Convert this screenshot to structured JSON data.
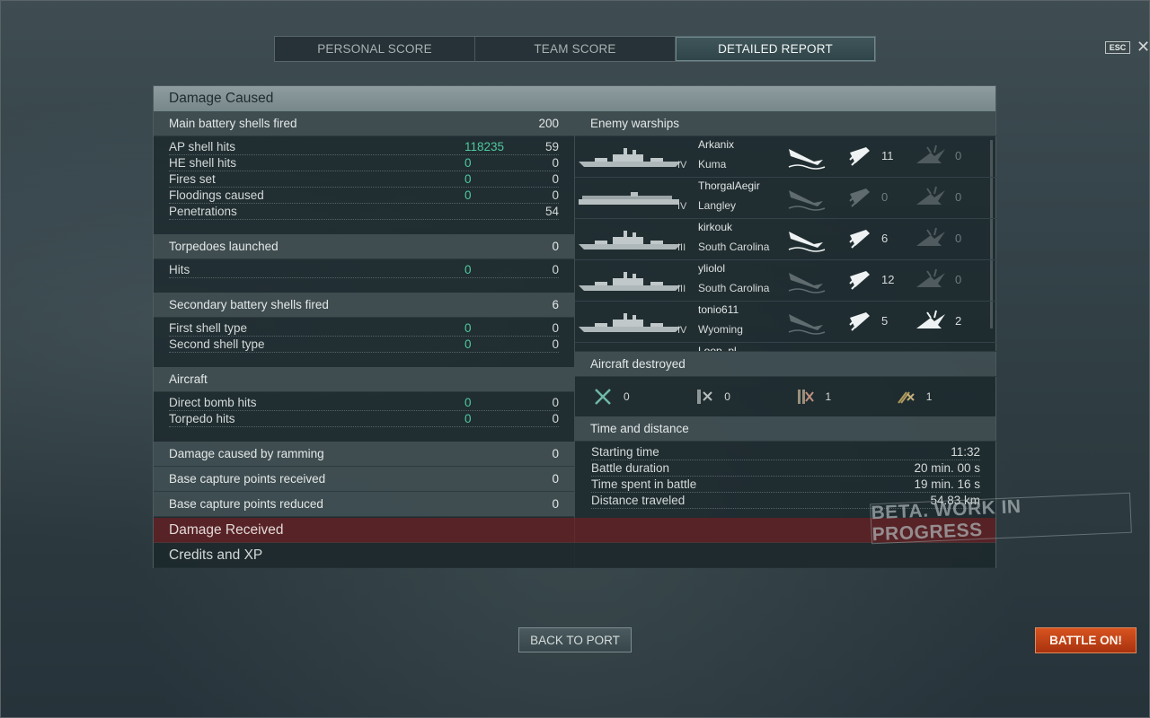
{
  "tabs": [
    {
      "label": "PERSONAL SCORE"
    },
    {
      "label": "TEAM SCORE"
    },
    {
      "label": "DETAILED REPORT"
    }
  ],
  "esc_label": "ESC",
  "close_glyph": "✕",
  "panel": {
    "title": "Damage Caused",
    "main_battery": {
      "title": "Main battery shells fired",
      "value": "200",
      "rows": [
        {
          "label": "AP shell hits",
          "v1": "118235",
          "v2": "59"
        },
        {
          "label": "HE shell hits",
          "v1": "0",
          "v2": "0"
        },
        {
          "label": "Fires set",
          "v1": "0",
          "v2": "0"
        },
        {
          "label": "Floodings caused",
          "v1": "0",
          "v2": "0"
        },
        {
          "label": "Penetrations",
          "v1": "",
          "v2": "54"
        }
      ]
    },
    "torpedoes": {
      "title": "Torpedoes launched",
      "value": "0",
      "rows": [
        {
          "label": "Hits",
          "v1": "0",
          "v2": "0"
        }
      ]
    },
    "secondary": {
      "title": "Secondary battery shells fired",
      "value": "6",
      "rows": [
        {
          "label": "First shell type",
          "v1": "0",
          "v2": "0"
        },
        {
          "label": "Second shell type",
          "v1": "0",
          "v2": "0"
        }
      ]
    },
    "aircraft": {
      "title": "Aircraft",
      "value": "",
      "rows": [
        {
          "label": "Direct bomb hits",
          "v1": "0",
          "v2": "0"
        },
        {
          "label": "Torpedo hits",
          "v1": "0",
          "v2": "0"
        }
      ]
    },
    "ramming": {
      "title": "Damage caused by ramming",
      "value": "0"
    },
    "base_received": {
      "title": "Base capture points received",
      "value": "0"
    },
    "base_reduced": {
      "title": "Base capture points reduced",
      "value": "0"
    },
    "enemy": {
      "title": "Enemy warships",
      "ships": [
        {
          "player": "Arkanix",
          "ship": "Kuma",
          "tier": "IV",
          "sunk": true,
          "hits": "11",
          "fire": "0",
          "fire_active": false,
          "hits_active": true
        },
        {
          "player": "ThorgalAegir",
          "ship": "Langley",
          "tier": "IV",
          "sunk": false,
          "hits": "0",
          "fire": "0",
          "fire_active": false,
          "hits_active": false
        },
        {
          "player": "kirkouk",
          "ship": "South Carolina",
          "tier": "III",
          "sunk": true,
          "hits": "6",
          "fire": "0",
          "fire_active": false,
          "hits_active": true
        },
        {
          "player": "yliolol",
          "ship": "South Carolina",
          "tier": "III",
          "sunk": false,
          "hits": "12",
          "fire": "0",
          "fire_active": false,
          "hits_active": true
        },
        {
          "player": "tonio611",
          "ship": "Wyoming",
          "tier": "IV",
          "sunk": false,
          "hits": "5",
          "fire": "2",
          "fire_active": true,
          "hits_active": true
        },
        {
          "player": "Loop_pl",
          "ship": "",
          "tier": "",
          "sunk": true,
          "hits": "",
          "fire": "",
          "fire_active": false,
          "hits_active": true
        }
      ]
    },
    "aircraft_destroyed": {
      "title": "Aircraft destroyed",
      "items": [
        {
          "icon": "fighter-icon",
          "value": "0"
        },
        {
          "icon": "bomber-icon",
          "value": "0"
        },
        {
          "icon": "torpedo-bomber-icon",
          "value": "1"
        },
        {
          "icon": "dive-bomber-icon",
          "value": "1"
        }
      ]
    },
    "time_distance": {
      "title": "Time and distance",
      "rows": [
        {
          "label": "Starting time",
          "value": "11:32"
        },
        {
          "label": "Battle duration",
          "value": "20 min. 00 s"
        },
        {
          "label": "Time spent in battle",
          "value": "19 min. 16 s"
        },
        {
          "label": "Distance traveled",
          "value": "54.83 km"
        }
      ]
    }
  },
  "damage_received": "Damage Received",
  "credits_xp": "Credits and XP",
  "beta_label": "BETA. WORK IN PROGRESS",
  "back_to_port": "BACK TO PORT",
  "battle_on": "BATTLE ON!",
  "colors": {
    "accent_green": "#4fc9a0",
    "battle_orange": "#c9441a",
    "received_red": "#6e2022"
  }
}
